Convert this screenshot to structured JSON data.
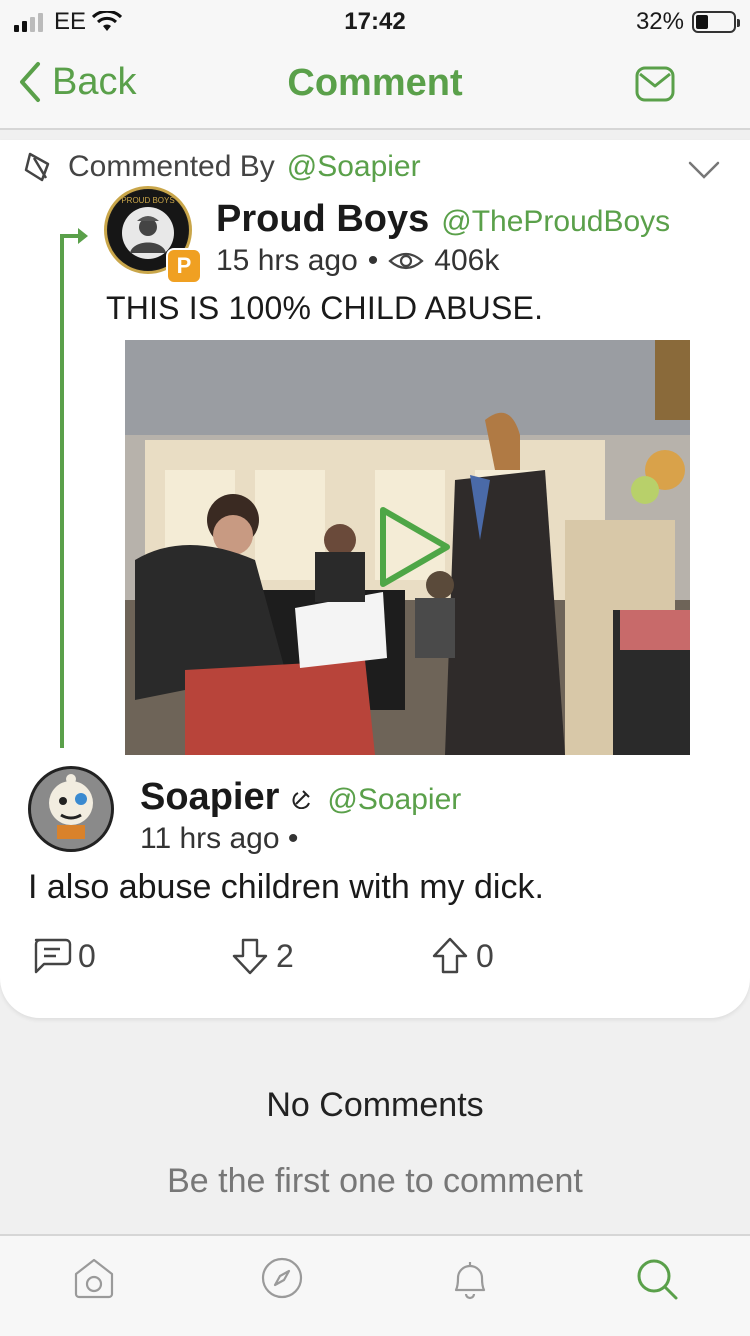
{
  "status_bar": {
    "carrier": "EE",
    "time": "17:42",
    "battery": "32%"
  },
  "nav": {
    "back_label": "Back",
    "title": "Comment"
  },
  "header": {
    "commented_by_label": "Commented By",
    "commented_by_handle": "@Soapier"
  },
  "original_post": {
    "name": "Proud Boys",
    "handle": "@TheProudBoys",
    "time": "15 hrs ago",
    "separator": "•",
    "views": "406k",
    "text": "THIS IS 100% CHILD ABUSE.",
    "badge_letter": "P",
    "avatar_text": "PROUD BOYS"
  },
  "comment": {
    "name": "Soapier",
    "handle": "@Soapier",
    "time": "11 hrs ago",
    "separator": "•",
    "text": "I also abuse children with my dick.",
    "replies": "0",
    "downvotes": "2",
    "upvotes": "0"
  },
  "empty_state": {
    "title": "No Comments",
    "subtitle": "Be the first one to comment"
  },
  "colors": {
    "accent": "#5aa04a",
    "text": "#1a1a1a"
  },
  "icons": [
    "signal-icon",
    "wifi-icon",
    "battery-icon",
    "chevron-left-icon",
    "mail-icon",
    "comment-bubble-icon",
    "chevron-down-icon",
    "eye-icon",
    "play-icon",
    "reply-icon",
    "downvote-icon",
    "upvote-icon",
    "home-icon",
    "compass-icon",
    "bell-icon",
    "search-icon"
  ]
}
